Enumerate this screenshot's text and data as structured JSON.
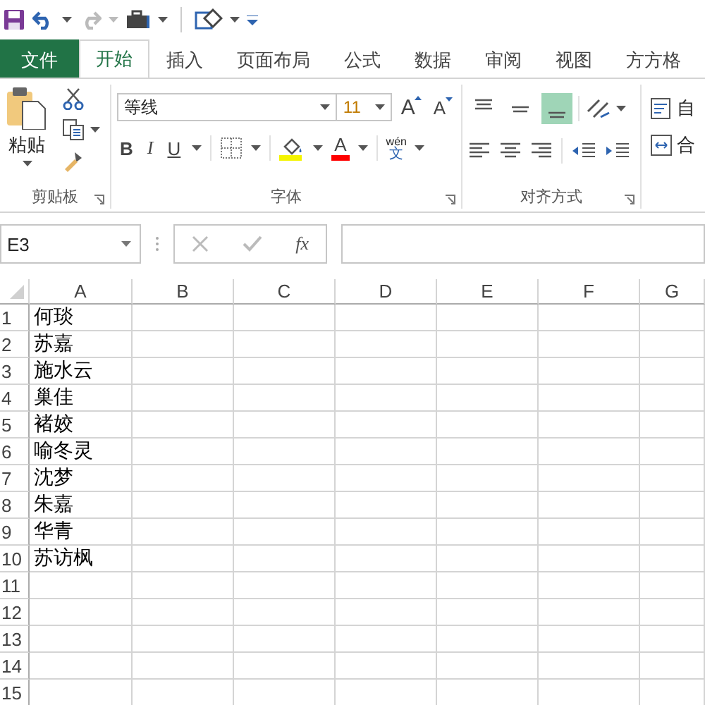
{
  "tabs": [
    {
      "label": "文件",
      "kind": "file",
      "selected": false
    },
    {
      "label": "开始",
      "kind": "tab",
      "selected": true
    },
    {
      "label": "插入",
      "kind": "tab",
      "selected": false
    },
    {
      "label": "页面布局",
      "kind": "tab",
      "selected": false
    },
    {
      "label": "公式",
      "kind": "tab",
      "selected": false
    },
    {
      "label": "数据",
      "kind": "tab",
      "selected": false
    },
    {
      "label": "审阅",
      "kind": "tab",
      "selected": false
    },
    {
      "label": "视图",
      "kind": "tab",
      "selected": false
    },
    {
      "label": "方方格",
      "kind": "tab",
      "selected": false
    }
  ],
  "ribbon": {
    "paste_label": "粘贴",
    "font_name": "等线",
    "font_size": "11",
    "grow_font": "A",
    "shrink_font": "A",
    "bold": "B",
    "italic": "I",
    "underline": "U",
    "font_color": "A",
    "phonetic_top": "wén",
    "phonetic_bottom": "文",
    "vertical_align": [
      {
        "selected": false
      },
      {
        "selected": false
      },
      {
        "selected": true
      }
    ],
    "wrap_label": "自",
    "merge_label": "合",
    "groups": [
      "剪贴板",
      "字体",
      "对齐方式"
    ]
  },
  "formula_bar": {
    "name_box": "E3",
    "fx": "fx"
  },
  "sheet": {
    "columns": [
      "A",
      "B",
      "C",
      "D",
      "E",
      "F",
      "G"
    ],
    "rows": [
      {
        "number": "1",
        "cells": [
          "何琰"
        ]
      },
      {
        "number": "2",
        "cells": [
          "苏嘉"
        ]
      },
      {
        "number": "3",
        "cells": [
          "施水云"
        ]
      },
      {
        "number": "4",
        "cells": [
          "巢佳"
        ]
      },
      {
        "number": "5",
        "cells": [
          "褚姣"
        ]
      },
      {
        "number": "6",
        "cells": [
          "喻冬灵"
        ]
      },
      {
        "number": "7",
        "cells": [
          "沈梦"
        ]
      },
      {
        "number": "8",
        "cells": [
          "朱嘉"
        ]
      },
      {
        "number": "9",
        "cells": [
          "华青"
        ]
      },
      {
        "number": "10",
        "cells": [
          "苏访枫"
        ]
      },
      {
        "number": "11",
        "cells": []
      },
      {
        "number": "12",
        "cells": []
      },
      {
        "number": "13",
        "cells": []
      },
      {
        "number": "14",
        "cells": []
      },
      {
        "number": "15",
        "cells": []
      }
    ]
  }
}
